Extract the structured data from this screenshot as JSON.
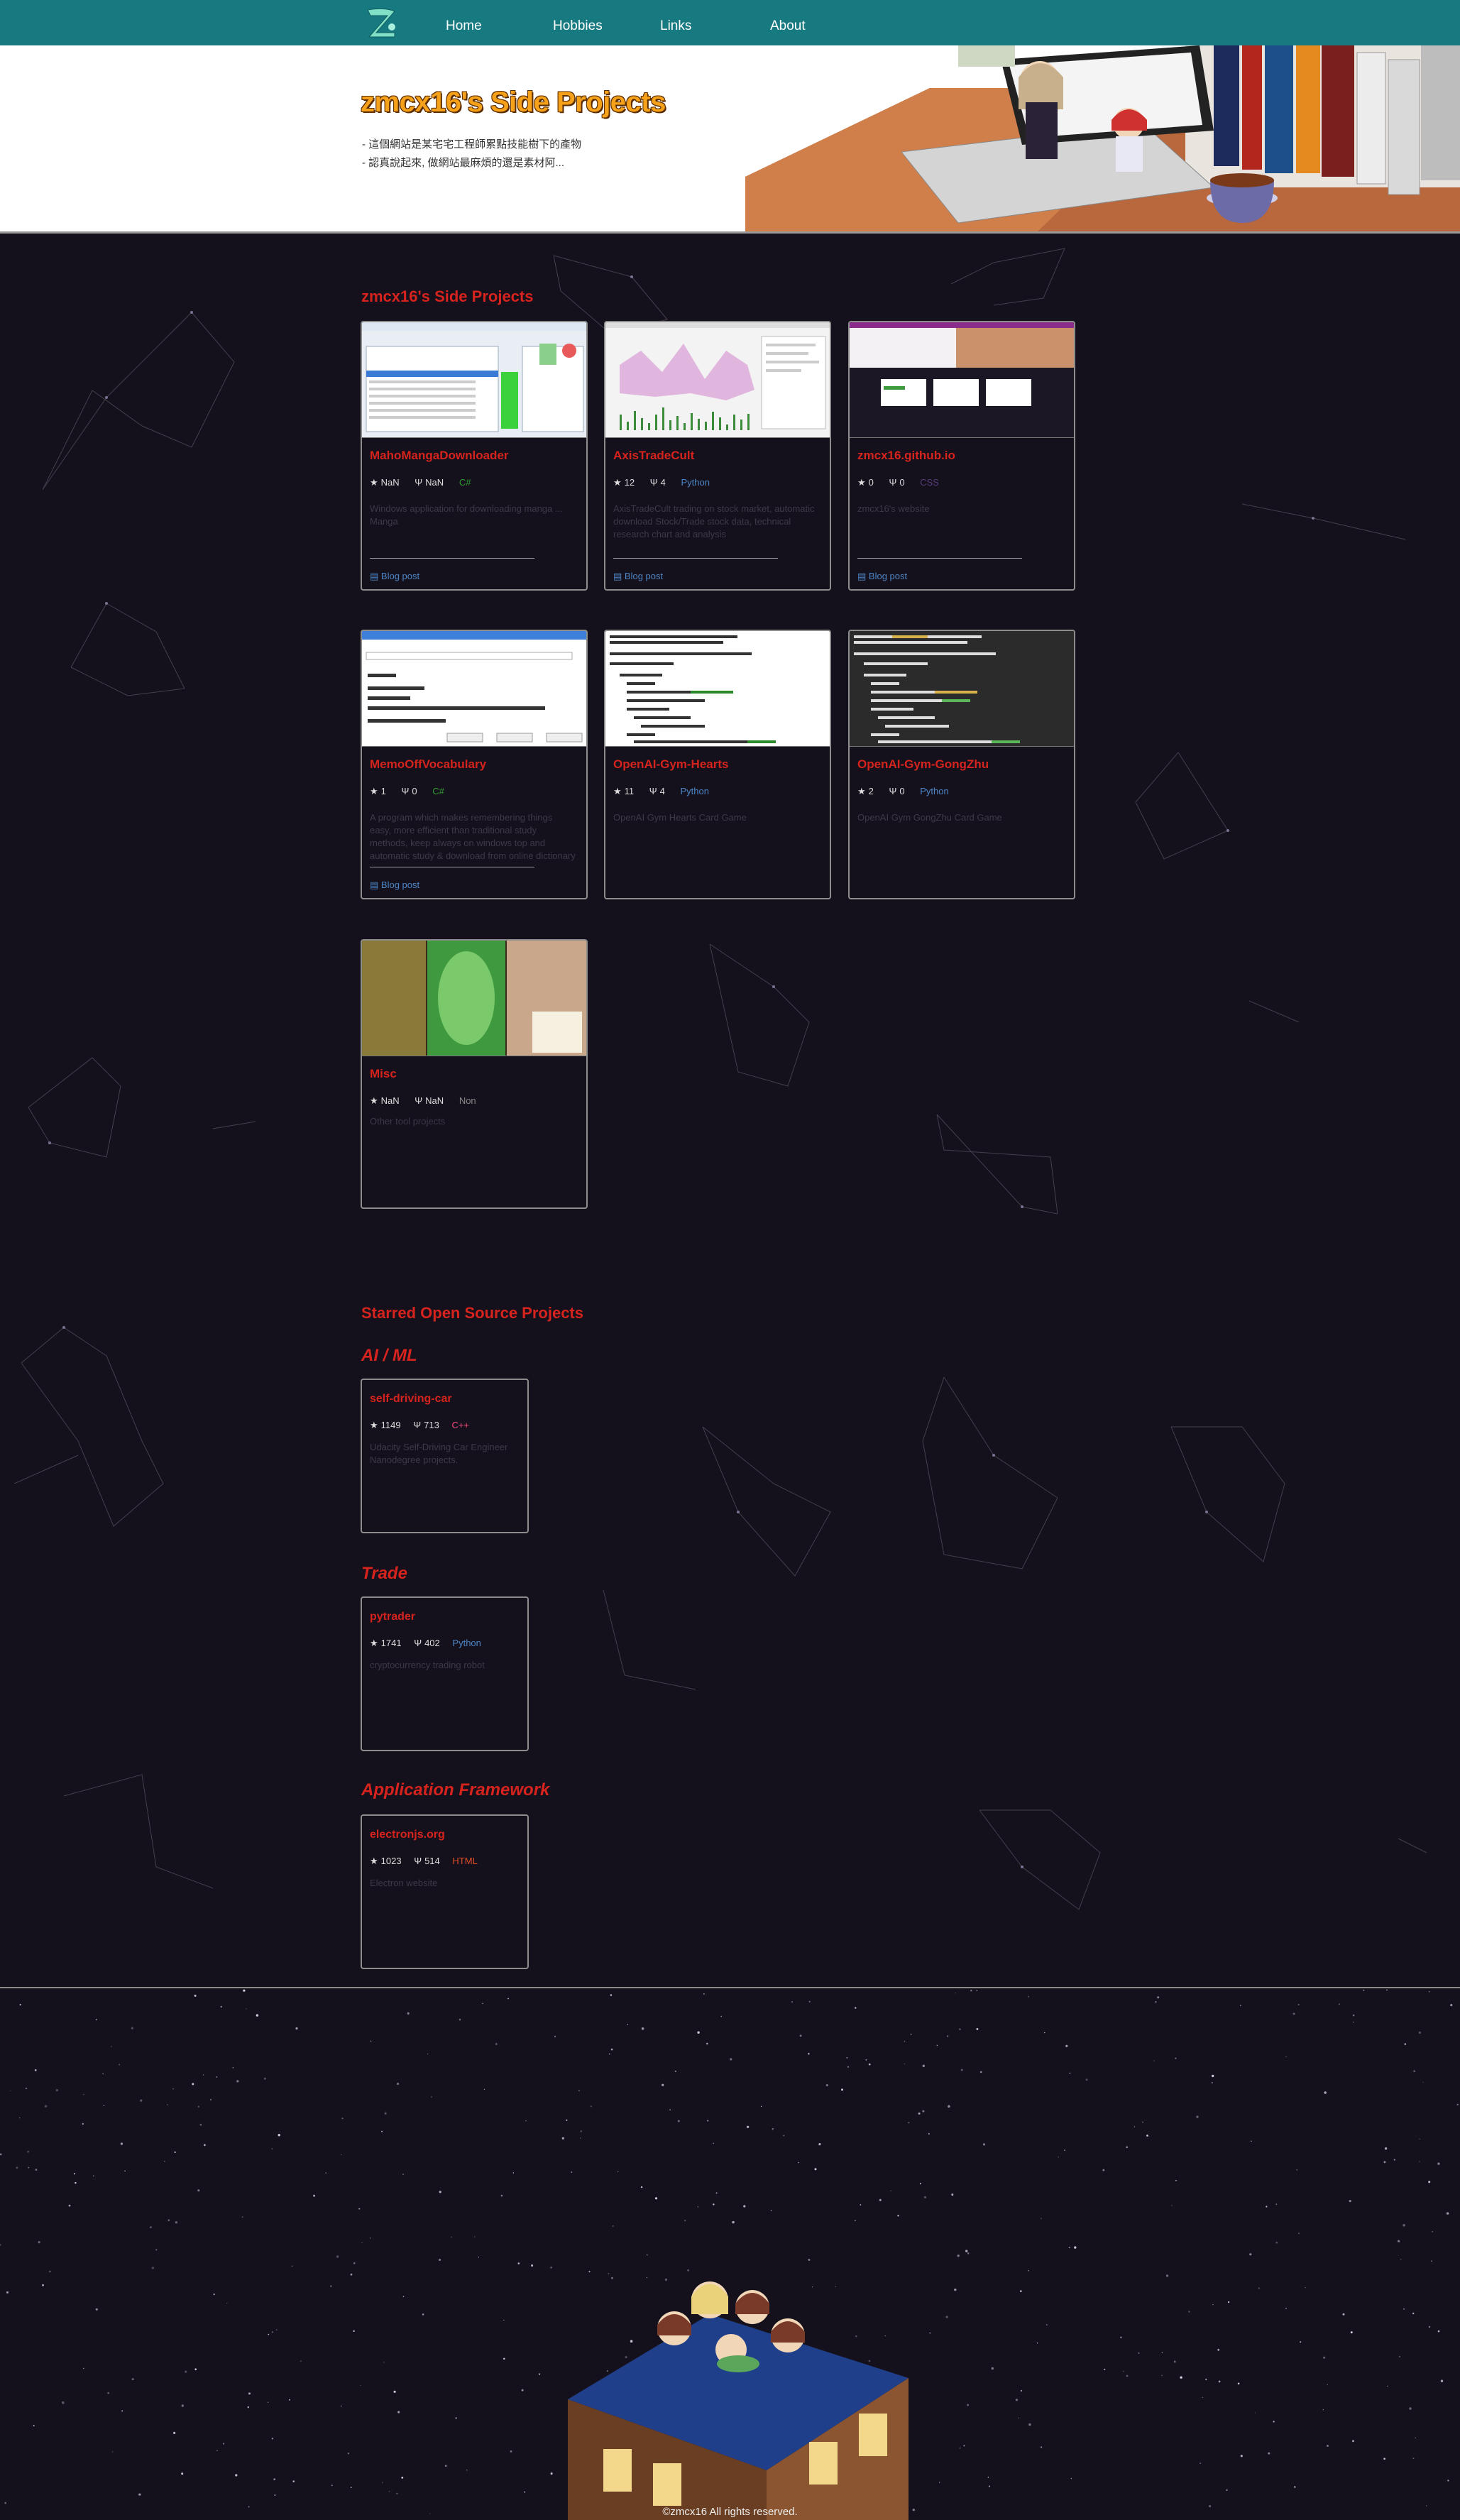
{
  "nav": {
    "items": [
      "Home",
      "Hobbies",
      "Links",
      "About"
    ]
  },
  "banner": {
    "title": "zmcx16's Side Projects",
    "lines": [
      "- 這個網站是某宅宅工程師累點技能樹下的產物",
      "- 認真說起來, 做網站最麻煩的還是素材阿..."
    ]
  },
  "side_projects": {
    "title": "zmcx16's Side Projects",
    "cards": [
      {
        "name": "MahoMangaDownloader",
        "stars": "NaN",
        "forks": "NaN",
        "lang": "C#",
        "desc": "Windows application for downloading manga ... Manga",
        "blog": "Blog post"
      },
      {
        "name": "AxisTradeCult",
        "stars": "12",
        "forks": "4",
        "lang": "Python",
        "desc": "AxisTradeCult trading on stock market, automatic download Stock/Trade stock data, technical research chart and analysis",
        "blog": "Blog post"
      },
      {
        "name": "zmcx16.github.io",
        "stars": "0",
        "forks": "0",
        "lang": "CSS",
        "desc": "zmcx16's website",
        "blog": "Blog post"
      },
      {
        "name": "MemoOffVocabulary",
        "stars": "1",
        "forks": "0",
        "lang": "C#",
        "desc": "A program which makes remembering things easy, more efficient than traditional study methods, keep always on windows top and automatic study & download from online dictionary",
        "blog": "Blog post"
      },
      {
        "name": "OpenAI-Gym-Hearts",
        "stars": "11",
        "forks": "4",
        "lang": "Python",
        "desc": "OpenAI Gym Hearts Card Game",
        "blog": ""
      },
      {
        "name": "OpenAI-Gym-GongZhu",
        "stars": "2",
        "forks": "0",
        "lang": "Python",
        "desc": "OpenAI Gym GongZhu Card Game",
        "blog": ""
      },
      {
        "name": "Misc",
        "stars": "NaN",
        "forks": "NaN",
        "lang": "Non",
        "desc": "Other tool projects",
        "blog": ""
      }
    ]
  },
  "starred": {
    "title": "Starred Open Source Projects",
    "groups": [
      {
        "title": "AI / ML",
        "card": {
          "name": "self-driving-car",
          "stars": "1149",
          "forks": "713",
          "lang": "C++",
          "desc": "Udacity Self-Driving Car Engineer Nanodegree projects."
        }
      },
      {
        "title": "Trade",
        "card": {
          "name": "pytrader",
          "stars": "1741",
          "forks": "402",
          "lang": "Python",
          "desc": "cryptocurrency trading robot"
        }
      },
      {
        "title": "Application Framework",
        "card": {
          "name": "electronjs.org",
          "stars": "1023",
          "forks": "514",
          "lang": "HTML",
          "desc": "Electron website"
        }
      }
    ]
  },
  "footer": {
    "text": "©zmcx16 All rights reserved."
  },
  "icons": {
    "star": "star-icon",
    "fork": "fork-icon",
    "doc": "document-icon"
  },
  "colors": {
    "nav_bg": "#177a80",
    "page_bg": "#15111c",
    "accent_red": "#d6231d",
    "title_orange": "#f6a11a"
  }
}
